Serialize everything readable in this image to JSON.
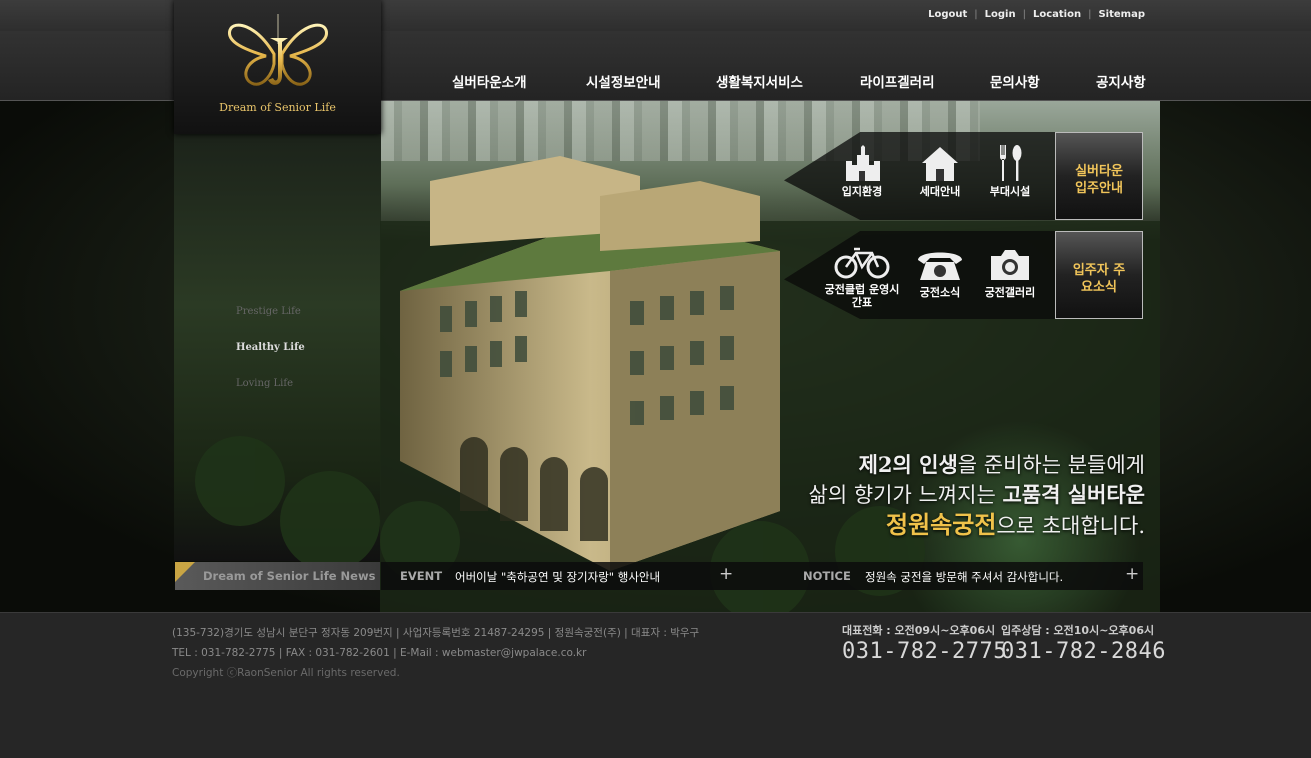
{
  "util_nav": [
    "Logout",
    "Login",
    "Location",
    "Sitemap"
  ],
  "logo": {
    "tagline": "Dream of Senior Life"
  },
  "gnb": [
    "실버타운소개",
    "시설정보안내",
    "생활복지서비스",
    "라이프겔러리",
    "문의사항",
    "공지사항"
  ],
  "slogans": [
    "Prestige Life",
    "Healthy Life",
    "Loving Life"
  ],
  "quick_menu": {
    "row1": [
      "입지환경",
      "세대안내",
      "부대시설"
    ],
    "row2": [
      "궁전클럽 운영시간표",
      "궁전소식",
      "궁전갤러리"
    ],
    "box1": "실버타운 입주안내",
    "box2": "입주자 주요소식"
  },
  "headline": {
    "line1_a": "제2의 인생",
    "line1_b": "을 준비하는 분들에게",
    "line2_a": "삶의 향기가 느껴지는 ",
    "line2_b": "고품격 실버타운",
    "line3_a": "정원속궁전",
    "line3_b": "으로 초대합니다."
  },
  "news": {
    "label": "Dream of Senior Life News",
    "event_label": "EVENT",
    "event_text": "어버이날 \"축하공연 및  장기자랑\" 행사안내",
    "notice_label": "NOTICE",
    "notice_text": "정원속 궁전을 방문해 주셔서 감사합니다.",
    "plus": "+"
  },
  "footer": {
    "address": "(135-732)경기도 성남시 분단구 정자동 209번지  |  사업자등록번호 21487-24295  |  정원속궁전(주)  |  대표자 : 박우구",
    "contact": "TEL : 031-782-2775  |  FAX : 031-782-2601  |  E-Mail : webmaster@jwpalace.co.kr",
    "copyright": "Copyright ⓒRaonSenior All rights reserved.",
    "phone1_label": "대표전화 : 오전09시~오후06시",
    "phone1": "031-782-2775",
    "phone2_label": "입주상담 : 오전10시~오후06시",
    "phone2": "031-782-2846"
  },
  "colors": {
    "gold": "#f0c24a",
    "bg": "#262626"
  }
}
